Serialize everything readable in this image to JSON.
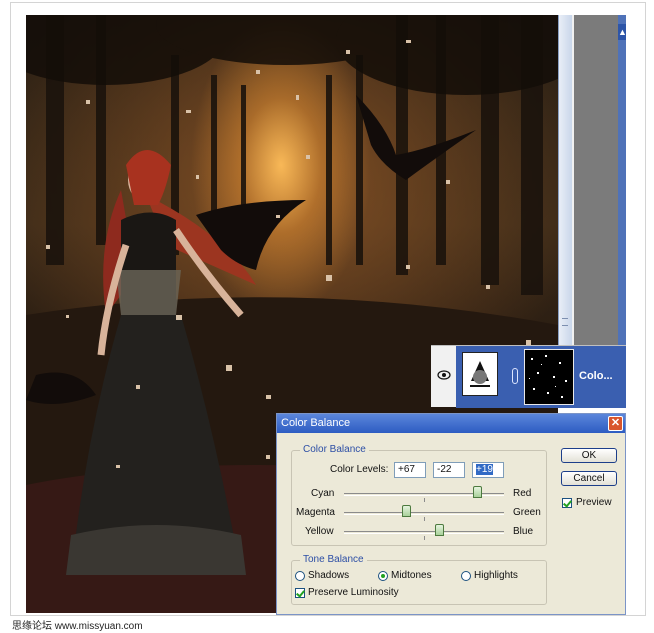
{
  "layers_panel": {
    "layer_name": "Colo..."
  },
  "dialog": {
    "title": "Color Balance",
    "close_label": "✕",
    "color_balance_group": "Color Balance",
    "color_levels_label": "Color Levels:",
    "levels": [
      "+67",
      "-22",
      "+19"
    ],
    "sliders": [
      {
        "left": "Cyan",
        "right": "Red",
        "value": 67
      },
      {
        "left": "Magenta",
        "right": "Green",
        "value": -22
      },
      {
        "left": "Yellow",
        "right": "Blue",
        "value": 19
      }
    ],
    "ok_label": "OK",
    "cancel_label": "Cancel",
    "preview_label": "Preview",
    "preview_checked": true,
    "tone_balance_group": "Tone Balance",
    "tones": [
      "Shadows",
      "Midtones",
      "Highlights"
    ],
    "selected_tone": "Midtones",
    "preserve_label": "Preserve Luminosity",
    "preserve_checked": true
  },
  "watermark": "思缘论坛  www.missyuan.com",
  "colors": {
    "title_blue": "#2d5cc2",
    "selection_blue": "#3a5fb0",
    "dialog_bg": "#ece9d8",
    "group_label": "#2c4ea5"
  }
}
